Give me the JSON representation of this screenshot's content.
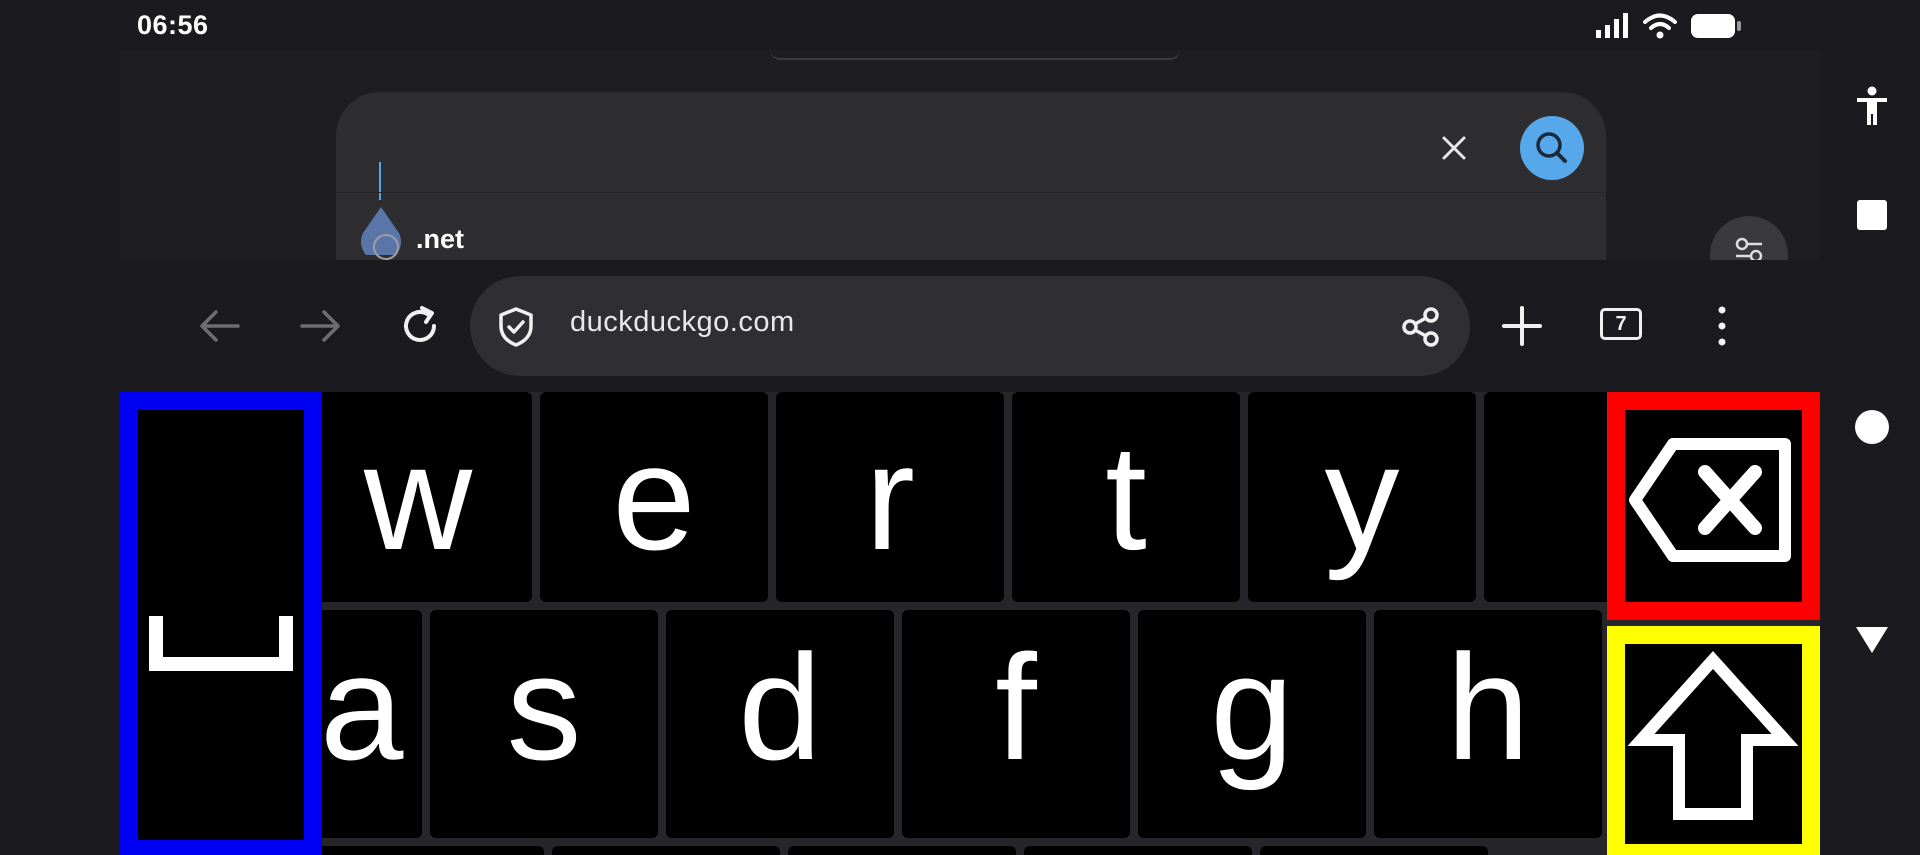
{
  "status": {
    "time": "06:56"
  },
  "search": {
    "query": "",
    "suggestion": ".net"
  },
  "browser": {
    "url": "duckduckgo.com",
    "tab_count": "7"
  },
  "keyboard": {
    "row1": [
      "w",
      "e",
      "r",
      "t",
      "y"
    ],
    "row2": [
      "a",
      "s",
      "d",
      "f",
      "g",
      "h"
    ],
    "space_label": "␣"
  },
  "colors": {
    "space_border": "#0000f2",
    "backspace_border": "#ff0000",
    "shift_border": "#ffff00",
    "search_accent": "#56a8ea"
  },
  "icons": {
    "accessibility": "accessibility-icon",
    "overview": "square-icon",
    "home": "circle-icon",
    "back": "triangle-down-icon"
  }
}
